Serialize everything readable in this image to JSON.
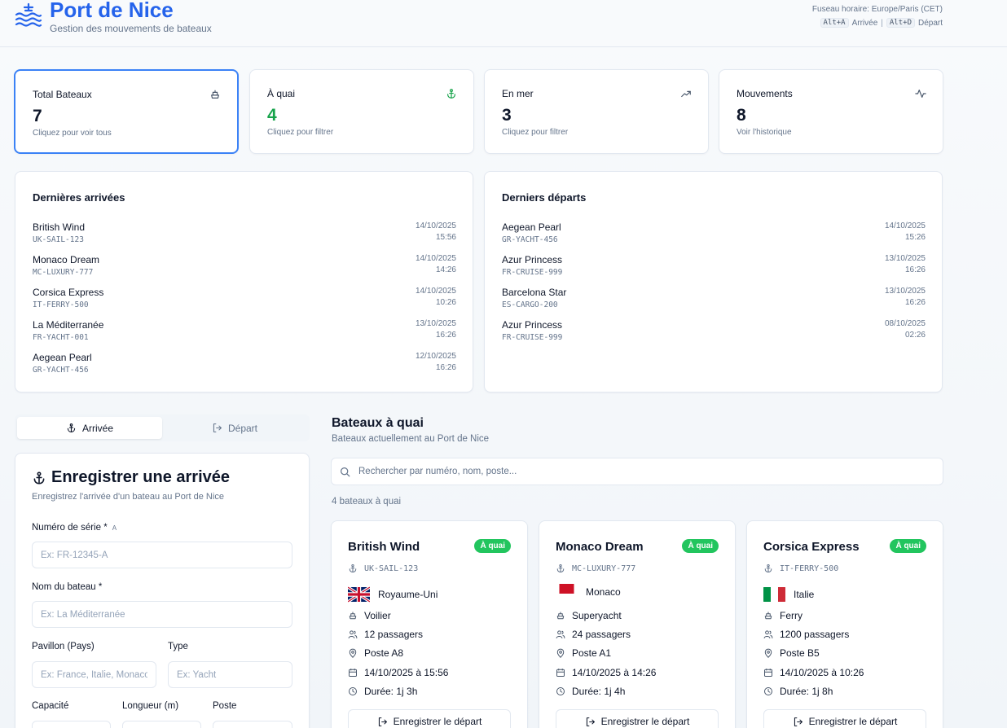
{
  "header": {
    "title": "Port de Nice",
    "subtitle": "Gestion des mouvements de bateaux",
    "timezone": "Fuseau horaire: Europe/Paris (CET)",
    "shortcut_arrival_key": "Alt+A",
    "shortcut_arrival_label": "Arrivée",
    "shortcut_departure_key": "Alt+D",
    "shortcut_departure_label": "Départ"
  },
  "stats": [
    {
      "label": "Total Bateaux",
      "value": "7",
      "hint": "Cliquez pour voir tous",
      "icon": "ship-icon",
      "color": "#0f172a"
    },
    {
      "label": "À quai",
      "value": "4",
      "hint": "Cliquez pour filtrer",
      "icon": "anchor-icon",
      "color": "#16a34a"
    },
    {
      "label": "En mer",
      "value": "3",
      "hint": "Cliquez pour filtrer",
      "icon": "trending-up-icon",
      "color": "#0f172a"
    },
    {
      "label": "Mouvements",
      "value": "8",
      "hint": "Voir l'historique",
      "icon": "activity-icon",
      "color": "#0f172a"
    }
  ],
  "arrivals": {
    "title": "Dernières arrivées",
    "items": [
      {
        "name": "British Wind",
        "id": "UK-SAIL-123",
        "date": "14/10/2025",
        "time": "15:56"
      },
      {
        "name": "Monaco Dream",
        "id": "MC-LUXURY-777",
        "date": "14/10/2025",
        "time": "14:26"
      },
      {
        "name": "Corsica Express",
        "id": "IT-FERRY-500",
        "date": "14/10/2025",
        "time": "10:26"
      },
      {
        "name": "La Méditerranée",
        "id": "FR-YACHT-001",
        "date": "13/10/2025",
        "time": "16:26"
      },
      {
        "name": "Aegean Pearl",
        "id": "GR-YACHT-456",
        "date": "12/10/2025",
        "time": "16:26"
      }
    ]
  },
  "departures": {
    "title": "Derniers départs",
    "items": [
      {
        "name": "Aegean Pearl",
        "id": "GR-YACHT-456",
        "date": "14/10/2025",
        "time": "15:26"
      },
      {
        "name": "Azur Princess",
        "id": "FR-CRUISE-999",
        "date": "13/10/2025",
        "time": "16:26"
      },
      {
        "name": "Barcelona Star",
        "id": "ES-CARGO-200",
        "date": "13/10/2025",
        "time": "16:26"
      },
      {
        "name": "Azur Princess",
        "id": "FR-CRUISE-999",
        "date": "08/10/2025",
        "time": "02:26"
      }
    ]
  },
  "tabs": {
    "arrival": "Arrivée",
    "departure": "Départ"
  },
  "form": {
    "title": "Enregistrer une arrivée",
    "subtitle": "Enregistrez l'arrivée d'un bateau au Port de Nice",
    "serial_label": "Numéro de série *",
    "serial_hint": "A",
    "serial_placeholder": "Ex: FR-12345-A",
    "name_label": "Nom du bateau *",
    "name_placeholder": "Ex: La Méditerranée",
    "flag_label": "Pavillon (Pays)",
    "flag_placeholder": "Ex: France, Italie, Monaco",
    "type_label": "Type",
    "type_placeholder": "Ex: Yacht",
    "capacity_label": "Capacité",
    "length_label": "Longueur (m)",
    "berth_label": "Poste"
  },
  "docked": {
    "title": "Bateaux à quai",
    "subtitle": "Bateaux actuellement au Port de Nice",
    "search_placeholder": "Rechercher par numéro, nom, poste...",
    "count": "4 bateaux à quai",
    "departure_button": "Enregistrer le départ",
    "boats": [
      {
        "name": "British Wind",
        "status": "À quai",
        "id": "UK-SAIL-123",
        "country": "Royaume-Uni",
        "flag": "uk",
        "type": "Voilier",
        "passengers": "12 passagers",
        "berth": "Poste A8",
        "arrived": "14/10/2025 à 15:56",
        "duration": "Durée: 1j 3h"
      },
      {
        "name": "Monaco Dream",
        "status": "À quai",
        "id": "MC-LUXURY-777",
        "country": "Monaco",
        "flag": "monaco",
        "type": "Superyacht",
        "passengers": "24 passagers",
        "berth": "Poste A1",
        "arrived": "14/10/2025 à 14:26",
        "duration": "Durée: 1j 4h"
      },
      {
        "name": "Corsica Express",
        "status": "À quai",
        "id": "IT-FERRY-500",
        "country": "Italie",
        "flag": "italy",
        "type": "Ferry",
        "passengers": "1200 passagers",
        "berth": "Poste B5",
        "arrived": "14/10/2025 à 10:26",
        "duration": "Durée: 1j 8h"
      }
    ]
  },
  "colors": {
    "accent": "#2563eb",
    "success": "#22c55e",
    "docked_value": "#16a34a"
  }
}
